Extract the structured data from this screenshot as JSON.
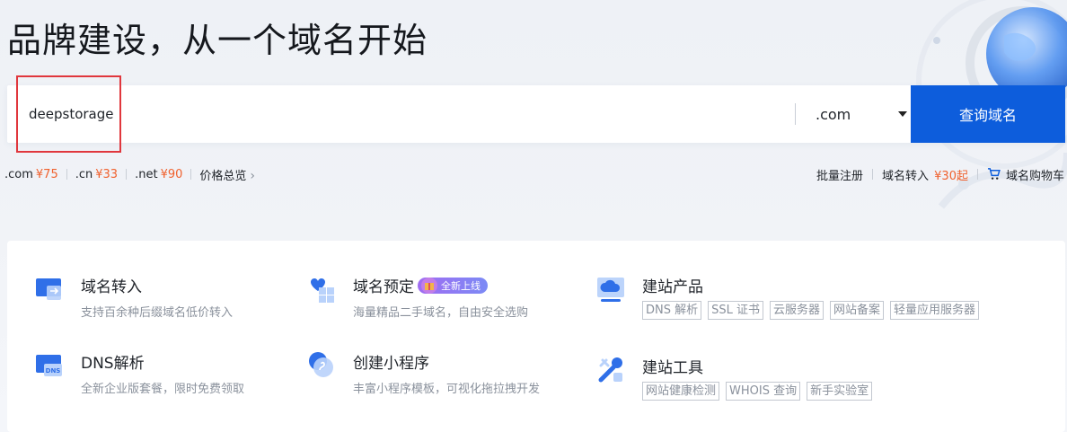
{
  "headline": "品牌建设，从一个域名开始",
  "search": {
    "value": "deepstorage",
    "placeholder": ""
  },
  "tld_select": {
    "selected": ".com"
  },
  "query_button": "查询域名",
  "prices": [
    {
      "tld": ".com",
      "price": "¥75"
    },
    {
      "tld": ".cn",
      "price": "¥33"
    },
    {
      "tld": ".net",
      "price": "¥90"
    }
  ],
  "price_overview": "价格总览",
  "right_links": {
    "bulk_register": "批量注册",
    "transfer": "域名转入",
    "transfer_price": "¥30起",
    "cart": "域名购物车"
  },
  "colors": {
    "accent": "#0d5ddc",
    "price": "#f0612e",
    "highlight_box": "#e0373d"
  },
  "services": [
    {
      "title": "域名转入",
      "desc": "支持百余种后缀域名低价转入",
      "icon": "domain-transfer-icon"
    },
    {
      "title": "域名预定",
      "badge": "全新上线",
      "desc": "海量精品二手域名，自由安全选购",
      "icon": "domain-reserve-icon"
    },
    {
      "title": "建站产品",
      "tags": [
        "DNS 解析",
        "SSL 证书",
        "云服务器",
        "网站备案",
        "轻量应用服务器"
      ],
      "icon": "site-building-icon"
    },
    {
      "title": "DNS解析",
      "desc": "全新企业版套餐，限时免费领取",
      "icon": "dns-icon"
    },
    {
      "title": "创建小程序",
      "desc": "丰富小程序模板，可视化拖拉拽开发",
      "icon": "mini-program-icon"
    },
    {
      "title": "建站工具",
      "tags": [
        "网站健康检测",
        "WHOIS 查询",
        "新手实验室"
      ],
      "icon": "site-tools-icon"
    }
  ]
}
